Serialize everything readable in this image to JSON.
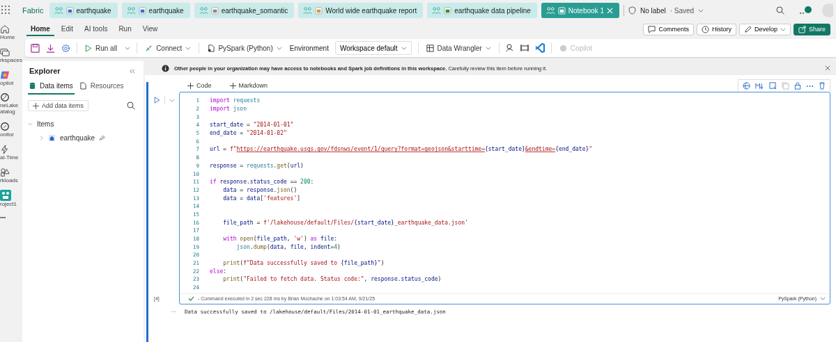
{
  "app_name": "Fabric",
  "tabs": [
    {
      "label": "earthquake",
      "kind": "lakehouse",
      "selected": false,
      "closable": false
    },
    {
      "label": "earthquake",
      "kind": "house",
      "selected": false,
      "closable": false
    },
    {
      "label": "earthquake_somantic",
      "kind": "model",
      "selected": false,
      "closable": false
    },
    {
      "label": "World wide earthquake report",
      "kind": "report",
      "selected": false,
      "closable": false
    },
    {
      "label": "earthquake data pipeline",
      "kind": "pipeline",
      "selected": false,
      "closable": false
    },
    {
      "label": "Notebook 1",
      "kind": "notebook",
      "selected": true,
      "closable": true
    }
  ],
  "sensitivity": "No label",
  "save_state": "· Saved",
  "rail": [
    {
      "label": "Home",
      "kind": "home"
    },
    {
      "label": "rkspaces",
      "kind": "workspaces"
    },
    {
      "label": "opilot",
      "kind": "copilot"
    },
    {
      "label": "neLake atalog",
      "kind": "catalog"
    },
    {
      "label": "onitor",
      "kind": "monitor"
    },
    {
      "label": "al-Time",
      "kind": "realtime"
    },
    {
      "label": "rkloads",
      "kind": "workloads"
    },
    {
      "label": "roject1",
      "kind": "project"
    },
    {
      "label": "•••",
      "kind": "more"
    }
  ],
  "ribbon_tabs": [
    {
      "label": "Home",
      "selected": true
    },
    {
      "label": "Edit",
      "selected": false
    },
    {
      "label": "AI tools",
      "selected": false
    },
    {
      "label": "Run",
      "selected": false
    },
    {
      "label": "View",
      "selected": false
    }
  ],
  "header_buttons": [
    {
      "label": "Comments",
      "kind": "comment"
    },
    {
      "label": "History",
      "kind": "history"
    },
    {
      "label": "Develop",
      "kind": "develop"
    },
    {
      "label": "Share",
      "kind": "share"
    }
  ],
  "toolbar": {
    "run_all": "Run all",
    "connect": "Connect",
    "language": "PySpark (Python)",
    "environment_label": "Environment",
    "environment": "Workspace default",
    "data_wrangler": "Data Wrangler",
    "copilot": "Copilot"
  },
  "explorer": {
    "title": "Explorer",
    "tabs": [
      {
        "label": "Data items",
        "selected": true
      },
      {
        "label": "Resources",
        "selected": false
      }
    ],
    "add_button": "Add data items",
    "section": {
      "label": "Items",
      "expanded": true,
      "children": [
        {
          "label": "earthquake",
          "expanded": false,
          "pinned": true
        }
      ]
    }
  },
  "banner": {
    "bold": "Other people in your organization may have access to notebooks and Spark job definitions in this workspace.",
    "text": "Carefully review this item before running it."
  },
  "cell_add": [
    "Code",
    "Markdown"
  ],
  "cell": {
    "exec_count": "[4]",
    "lines": [
      {
        "number": "1",
        "tokens": [
          {
            "kind": "kw",
            "text": "import"
          },
          {
            "kind": "id",
            "text": " requests"
          }
        ]
      },
      {
        "number": "2",
        "tokens": [
          {
            "kind": "kw",
            "text": "import"
          },
          {
            "kind": "id",
            "text": " json"
          }
        ]
      },
      {
        "number": "3"
      },
      {
        "number": "4",
        "tokens": [
          {
            "kind": "var",
            "text": "start_date"
          },
          {
            "kind": "p",
            "text": " = "
          },
          {
            "kind": "str",
            "text": "\"2014-01-01\""
          }
        ]
      },
      {
        "number": "5",
        "tokens": [
          {
            "kind": "var",
            "text": "end_date"
          },
          {
            "kind": "p",
            "text": " = "
          },
          {
            "kind": "str",
            "text": "\"2014-01-02\""
          }
        ]
      },
      {
        "number": "6"
      },
      {
        "number": "7",
        "tokens": [
          {
            "kind": "var",
            "text": "url"
          },
          {
            "kind": "p",
            "text": " = "
          },
          {
            "kind": "str",
            "text": "f\""
          },
          {
            "kind": "url",
            "text": "https://earthquake.usgs.gov/fdsnws/event/1/query?format=geojson&starttime="
          },
          {
            "kind": "var",
            "text": "{start_date}"
          },
          {
            "kind": "url",
            "text": "&endtime="
          },
          {
            "kind": "var",
            "text": "{end_date}"
          },
          {
            "kind": "str",
            "text": "\""
          }
        ]
      },
      {
        "number": "8"
      },
      {
        "number": "9",
        "tokens": [
          {
            "kind": "var",
            "text": "response"
          },
          {
            "kind": "p",
            "text": " = "
          },
          {
            "kind": "id",
            "text": "requests"
          },
          {
            "kind": "p",
            "text": "."
          },
          {
            "kind": "fn",
            "text": "get"
          },
          {
            "kind": "p",
            "text": "("
          },
          {
            "kind": "var",
            "text": "url"
          },
          {
            "kind": "p",
            "text": ")"
          }
        ]
      },
      {
        "number": "10"
      },
      {
        "number": "11",
        "tokens": [
          {
            "kind": "kw",
            "text": "if"
          },
          {
            "kind": "var",
            "text": " response"
          },
          {
            "kind": "p",
            "text": "."
          },
          {
            "kind": "var",
            "text": "status_code"
          },
          {
            "kind": "p",
            "text": " == "
          },
          {
            "kind": "num",
            "text": "200"
          },
          {
            "kind": "p",
            "text": ":"
          }
        ]
      },
      {
        "number": "12",
        "tokens": [
          {
            "kind": "var",
            "text": "    data"
          },
          {
            "kind": "p",
            "text": " = "
          },
          {
            "kind": "var",
            "text": "response"
          },
          {
            "kind": "p",
            "text": "."
          },
          {
            "kind": "fn",
            "text": "json"
          },
          {
            "kind": "p",
            "text": "()"
          }
        ]
      },
      {
        "number": "13",
        "tokens": [
          {
            "kind": "var",
            "text": "    data"
          },
          {
            "kind": "p",
            "text": " = "
          },
          {
            "kind": "var",
            "text": "data"
          },
          {
            "kind": "p",
            "text": "["
          },
          {
            "kind": "str",
            "text": "'features'"
          },
          {
            "kind": "p",
            "text": "]"
          }
        ]
      },
      {
        "number": "14"
      },
      {
        "number": "15"
      },
      {
        "number": "16",
        "tokens": [
          {
            "kind": "var",
            "text": "    file_path"
          },
          {
            "kind": "p",
            "text": " = "
          },
          {
            "kind": "str",
            "text": "f'/lakehouse/default/Files/"
          },
          {
            "kind": "var",
            "text": "{start_date}"
          },
          {
            "kind": "str",
            "text": "_earthquake_data.json'"
          }
        ]
      },
      {
        "number": "17"
      },
      {
        "number": "18",
        "tokens": [
          {
            "kind": "kw",
            "text": "    with"
          },
          {
            "kind": "fn",
            "text": " open"
          },
          {
            "kind": "p",
            "text": "("
          },
          {
            "kind": "var",
            "text": "file_path"
          },
          {
            "kind": "p",
            "text": ", "
          },
          {
            "kind": "str",
            "text": "'w'"
          },
          {
            "kind": "p",
            "text": ") "
          },
          {
            "kind": "kw",
            "text": "as"
          },
          {
            "kind": "var",
            "text": " file"
          },
          {
            "kind": "p",
            "text": ":"
          }
        ]
      },
      {
        "number": "19",
        "tokens": [
          {
            "kind": "id",
            "text": "        json"
          },
          {
            "kind": "p",
            "text": "."
          },
          {
            "kind": "fn",
            "text": "dump"
          },
          {
            "kind": "p",
            "text": "("
          },
          {
            "kind": "var",
            "text": "data"
          },
          {
            "kind": "p",
            "text": ", "
          },
          {
            "kind": "var",
            "text": "file"
          },
          {
            "kind": "p",
            "text": ", "
          },
          {
            "kind": "var",
            "text": "indent"
          },
          {
            "kind": "p",
            "text": "="
          },
          {
            "kind": "num",
            "text": "4"
          },
          {
            "kind": "p",
            "text": ")"
          }
        ]
      },
      {
        "number": "20"
      },
      {
        "number": "21",
        "tokens": [
          {
            "kind": "fn",
            "text": "    print"
          },
          {
            "kind": "p",
            "text": "("
          },
          {
            "kind": "str",
            "text": "f\"Data successfully saved to "
          },
          {
            "kind": "var",
            "text": "{file_path}"
          },
          {
            "kind": "str",
            "text": "\""
          },
          {
            "kind": "p",
            "text": ")"
          }
        ]
      },
      {
        "number": "22",
        "tokens": [
          {
            "kind": "kw",
            "text": "else"
          },
          {
            "kind": "p",
            "text": ":"
          }
        ]
      },
      {
        "number": "23",
        "tokens": [
          {
            "kind": "fn",
            "text": "    print"
          },
          {
            "kind": "p",
            "text": "("
          },
          {
            "kind": "str",
            "text": "\"Failed to fetch data. Status code:\""
          },
          {
            "kind": "p",
            "text": ", "
          },
          {
            "kind": "var",
            "text": "response"
          },
          {
            "kind": "p",
            "text": "."
          },
          {
            "kind": "var",
            "text": "status_code"
          },
          {
            "kind": "p",
            "text": ")"
          }
        ]
      },
      {
        "number": "24"
      }
    ],
    "status": "- Command executed in 2 sec 228 ms by Brian Mochache on 1:03:54 AM, 9/21/25",
    "language": "PySpark (Python)",
    "succeeded": true,
    "output_marker": "···",
    "output": "Data successfully saved to /lakehouse/default/Files/2014-01-01_earthquake_data.json"
  }
}
